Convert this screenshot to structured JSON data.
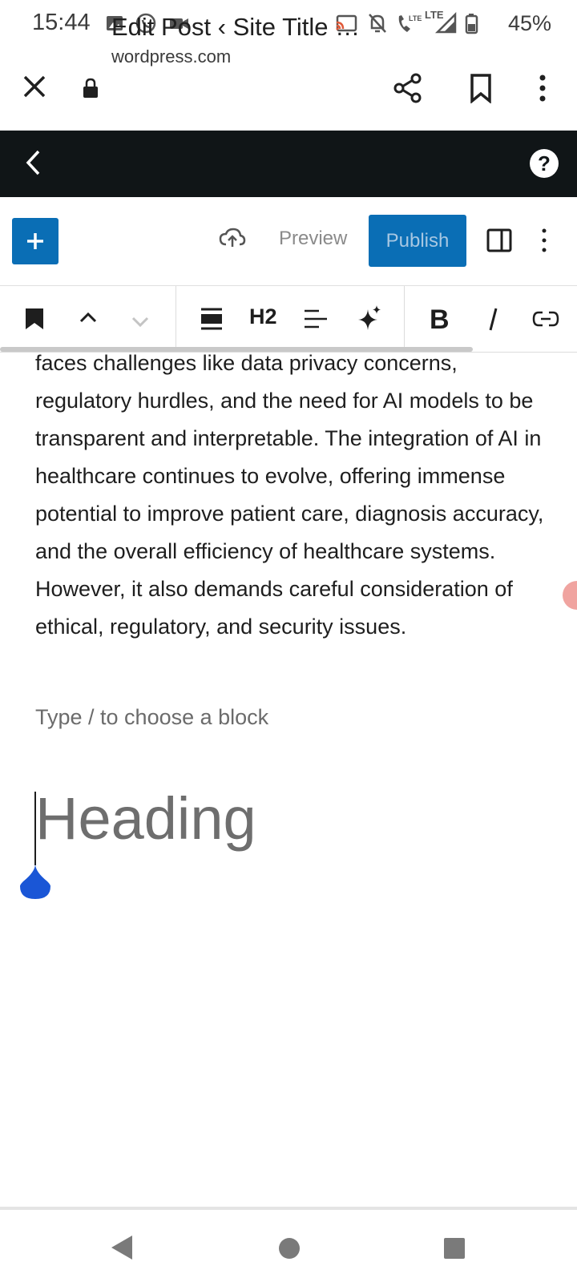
{
  "status_bar": {
    "time": "15:44",
    "network": "LTE",
    "battery": "45%",
    "icons": [
      "image-icon",
      "whatsapp-icon",
      "video-icon",
      "cast-icon",
      "bell-off-icon",
      "volte-call-icon",
      "signal-icon",
      "battery-icon"
    ]
  },
  "browser": {
    "title": "Edit Post ‹ Site Title …",
    "url": "wordpress.com",
    "icons": [
      "close-icon",
      "lock-icon",
      "share-icon",
      "bookmark-icon",
      "more-vertical-icon"
    ]
  },
  "wp_topbar": {
    "icons": [
      "back-chevron-icon",
      "help-icon"
    ]
  },
  "editor_header": {
    "add_label": "+",
    "preview_label": "Preview",
    "publish_label": "Publish",
    "accent_color": "#0a6eb5"
  },
  "block_toolbar": {
    "heading_level_label": "H2",
    "icons": [
      "bookmark-block-icon",
      "chevron-up-icon",
      "chevron-down-icon",
      "align-wide-icon",
      "text-align-icon",
      "ai-sparkle-icon",
      "bold-icon",
      "italic-icon",
      "link-icon"
    ]
  },
  "content": {
    "paragraph": "faces challenges like data privacy concerns, regulatory hurdles, and the need for AI models to be transparent and interpretable. The integration of AI in healthcare continues to evolve, offering immense potential to improve patient care, diagnosis accuracy, and the overall efficiency of healthcare systems. However, it also demands careful consideration of ethical, regulatory, and security issues.",
    "block_placeholder": "Type / to choose a block",
    "heading_placeholder": "Heading"
  },
  "nav_bar": {
    "icons": [
      "back-triangle-icon",
      "home-circle-icon",
      "recents-square-icon"
    ]
  }
}
